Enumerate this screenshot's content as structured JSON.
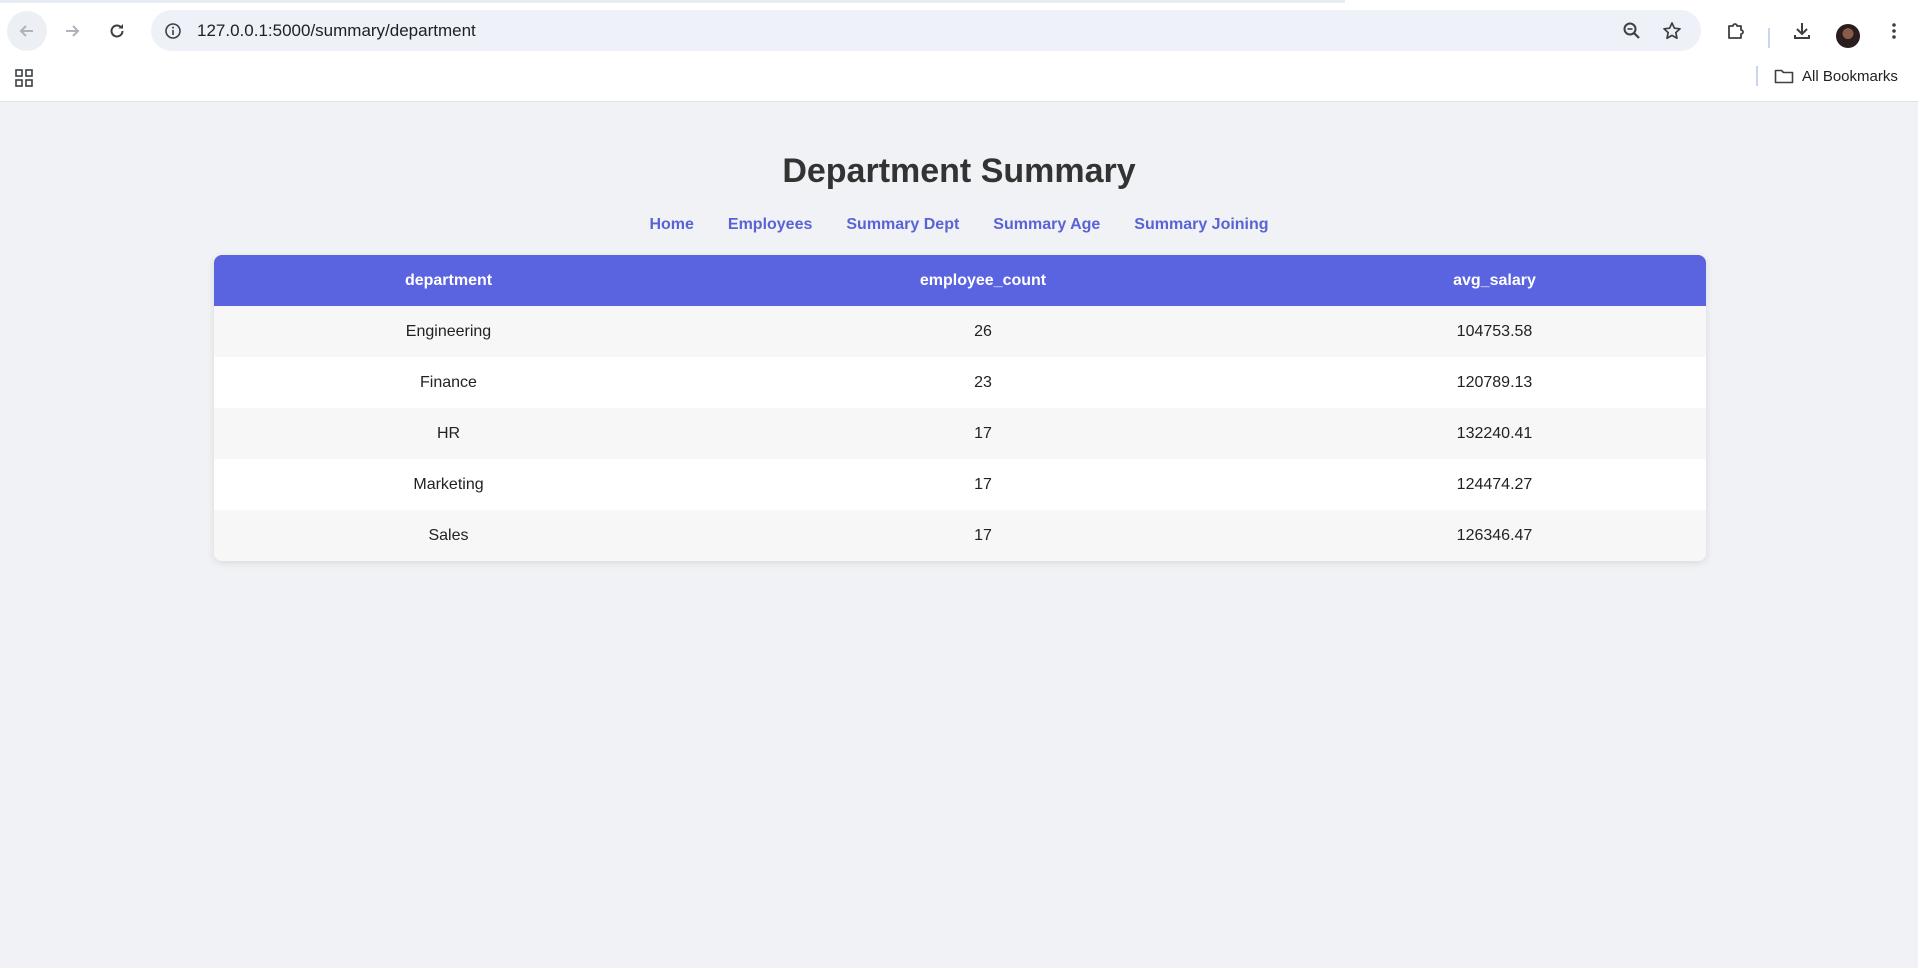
{
  "browser": {
    "url": "127.0.0.1:5000/summary/department",
    "bookmarks_label": "All Bookmarks"
  },
  "icons": {
    "back": "arrow-left-icon",
    "forward": "arrow-right-icon",
    "reload": "reload-icon",
    "info": "info-icon",
    "zoom": "zoom-icon",
    "star": "star-icon",
    "extensions": "puzzle-icon",
    "download": "download-icon",
    "menu": "kebab-menu-icon",
    "apps": "apps-grid-icon",
    "folder": "folder-icon"
  },
  "colors": {
    "accent": "#5a63e0",
    "nav_link": "#5a63d6",
    "page_bg": "#f0f2f5"
  },
  "page": {
    "title": "Department Summary",
    "nav": [
      "Home",
      "Employees",
      "Summary Dept",
      "Summary Age",
      "Summary Joining"
    ]
  },
  "table": {
    "columns": [
      "department",
      "employee_count",
      "avg_salary"
    ],
    "rows": [
      [
        "Engineering",
        "26",
        "104753.58"
      ],
      [
        "Finance",
        "23",
        "120789.13"
      ],
      [
        "HR",
        "17",
        "132240.41"
      ],
      [
        "Marketing",
        "17",
        "124474.27"
      ],
      [
        "Sales",
        "17",
        "126346.47"
      ]
    ]
  }
}
